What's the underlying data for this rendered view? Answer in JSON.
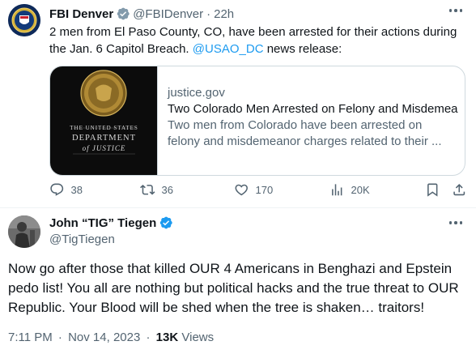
{
  "tweet1": {
    "author_name": "FBI Denver",
    "handle": "@FBIDenver",
    "separator": "·",
    "time": "22h",
    "text_before": "2 men from El Paso County, CO, have been arrested for their actions during the Jan. 6 Capitol Breach.  ",
    "mention": "@USAO_DC",
    "text_after": " news release:",
    "card": {
      "image_line1": "THE UNITED STATES",
      "image_line2": "DEPARTMENT",
      "image_line3": "of JUSTICE",
      "domain": "justice.gov",
      "title": "Two Colorado Men Arrested on Felony and Misdemea",
      "description_line1": "Two men from Colorado have been arrested on",
      "description_line2": "felony and misdemeanor charges related to their ..."
    },
    "actions": {
      "replies": "38",
      "reposts": "36",
      "likes": "170",
      "views": "20K"
    }
  },
  "tweet2": {
    "author_name": "John “TIG” Tiegen",
    "handle": "@TigTiegen",
    "text": "Now go after those that killed OUR 4 Americans in Benghazi and Epstein pedo list!  You all are nothing but political hacks and the true threat to OUR Republic. Your Blood will be shed when the tree is shaken… traitors!",
    "time": "7:11 PM",
    "date": "Nov 14, 2023",
    "separator": "·",
    "views_count": "13K",
    "views_label": "Views"
  },
  "colors": {
    "verified_blue": "#1d9bf0",
    "link_blue": "#1d9bf0",
    "muted": "#536471",
    "text": "#0f1419"
  }
}
